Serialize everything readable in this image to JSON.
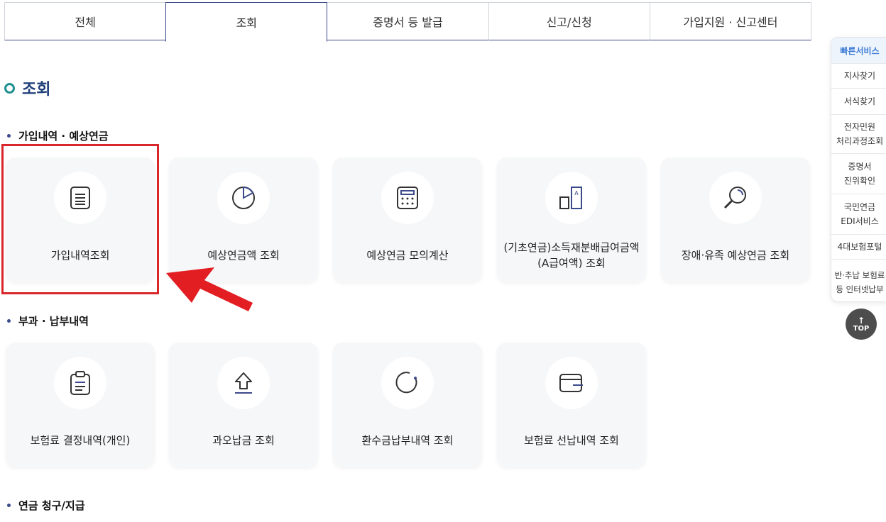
{
  "tabs": [
    "전체",
    "조회",
    "증명서 등 발급",
    "신고/신청",
    "가입지원 · 신고센터"
  ],
  "page_title": "조회",
  "sections": [
    {
      "title": "가입내역 · 예상연금",
      "cards": [
        {
          "label": "가입내역조회",
          "icon": "document-list-icon"
        },
        {
          "label": "예상연금액 조회",
          "icon": "pie-chart-icon"
        },
        {
          "label": "예상연금 모의계산",
          "icon": "calculator-icon"
        },
        {
          "label": "(기초연금)소득재분배급여금액(A급여액) 조회",
          "icon": "bar-compare-icon"
        },
        {
          "label": "장애·유족 예상연금 조회",
          "icon": "magnifier-icon"
        }
      ]
    },
    {
      "title": "부과 · 납부내역",
      "cards": [
        {
          "label": "보험료 결정내역(개인)",
          "icon": "clipboard-icon"
        },
        {
          "label": "과오납금 조회",
          "icon": "upload-arrow-icon"
        },
        {
          "label": "환수금납부내역 조회",
          "icon": "refresh-circle-icon"
        },
        {
          "label": "보험료 선납내역 조회",
          "icon": "wallet-icon"
        }
      ]
    },
    {
      "title": "연금 청구/지급",
      "cards": []
    }
  ],
  "quick_service": {
    "title": "빠른서비스",
    "items": [
      "지사찾기",
      "서식찾기",
      "전자민원\n처리과정조회",
      "증명서\n진위확인",
      "국민연금\nEDI서비스",
      "4대보험포털",
      "반·추납 보험료\n등 인터넷납부"
    ]
  },
  "top_button": "TOP",
  "colors": {
    "accent": "#3b4a8a",
    "title": "#1f3f7a",
    "highlight": "#d8262a",
    "quick_head": "#3b7bd6"
  }
}
